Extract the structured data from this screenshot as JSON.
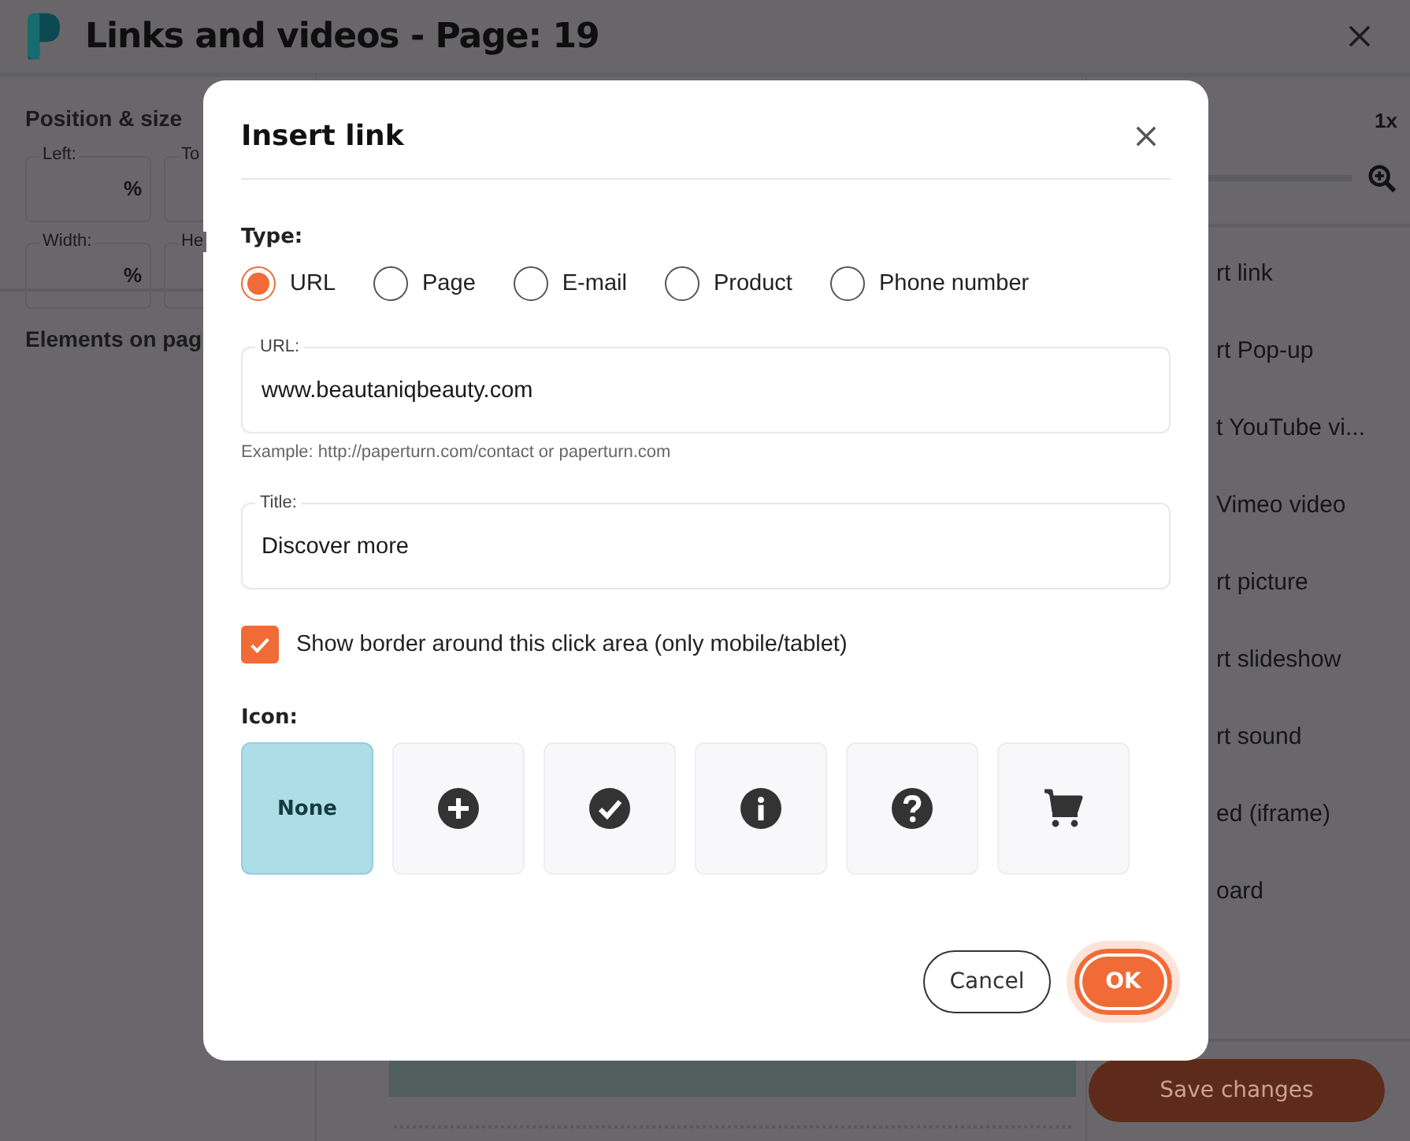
{
  "header": {
    "title": "Links and videos - Page: 19"
  },
  "left_panel": {
    "heading": "Position & size",
    "fields": [
      {
        "label": "Left:",
        "unit": "%"
      },
      {
        "label": "To"
      },
      {
        "label": "Width:",
        "unit": "%"
      },
      {
        "label": "He"
      }
    ],
    "elements_heading": "Elements on pag"
  },
  "right_panel": {
    "zoom": "1x",
    "items": [
      "rt link",
      "rt Pop-up",
      "t YouTube vi...",
      "Vimeo video",
      "rt picture",
      "rt slideshow",
      "rt sound",
      "ed (iframe)",
      "oard"
    ],
    "save_button": "Save changes"
  },
  "dialog": {
    "title": "Insert link",
    "type_label": "Type:",
    "types": [
      {
        "label": "URL",
        "selected": true
      },
      {
        "label": "Page",
        "selected": false
      },
      {
        "label": "E-mail",
        "selected": false
      },
      {
        "label": "Product",
        "selected": false
      },
      {
        "label": "Phone number",
        "selected": false
      }
    ],
    "url_field": {
      "label": "URL:",
      "value": "www.beautaniqbeauty.com",
      "hint": "Example: http://paperturn.com/contact or paperturn.com"
    },
    "title_field": {
      "label": "Title:",
      "value": "Discover more"
    },
    "border_checkbox": {
      "label": "Show border around this click area (only mobile/tablet)",
      "checked": true
    },
    "icon_label": "Icon:",
    "icons": [
      {
        "kind": "none",
        "label": "None",
        "selected": true
      },
      {
        "kind": "plus",
        "selected": false
      },
      {
        "kind": "check",
        "selected": false
      },
      {
        "kind": "info",
        "selected": false
      },
      {
        "kind": "question",
        "selected": false
      },
      {
        "kind": "cart",
        "selected": false
      }
    ],
    "buttons": {
      "cancel": "Cancel",
      "ok": "OK"
    }
  }
}
